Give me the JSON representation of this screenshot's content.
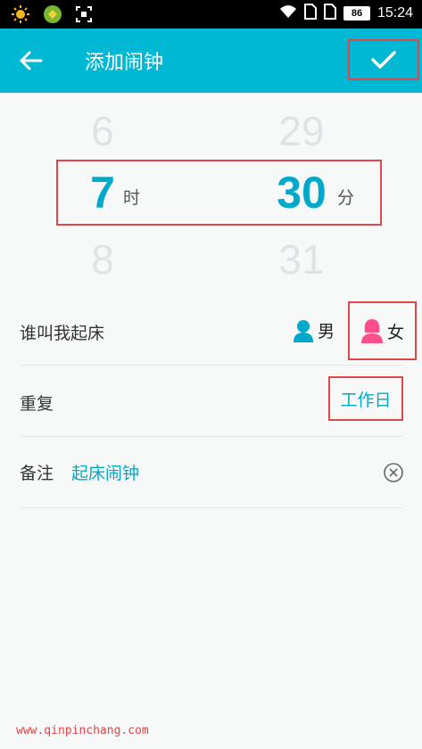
{
  "status_bar": {
    "icons": [
      "sun-icon",
      "app-notification-icon",
      "screenshot-icon",
      "wifi-icon",
      "sim-icon",
      "sim2-icon"
    ],
    "battery": "86",
    "time": "15:24"
  },
  "app_bar": {
    "title": "添加闹钟",
    "back_icon": "arrow-left-icon",
    "confirm_icon": "check-icon"
  },
  "picker": {
    "hour": {
      "prev": "6",
      "selected": "7",
      "next": "8",
      "unit": "时"
    },
    "minute": {
      "prev": "29",
      "selected": "30",
      "next": "31",
      "unit": "分"
    }
  },
  "form": {
    "wake_label": "谁叫我起床",
    "male_label": "男",
    "female_label": "女",
    "repeat_label": "重复",
    "repeat_value": "工作日",
    "note_label": "备注",
    "note_value": "起床闹钟"
  },
  "colors": {
    "accent": "#00b8d4",
    "accent_text": "#00a9c9",
    "female": "#ff4f8b",
    "highlight": "#e0464a"
  },
  "watermark": "www.qinpinchang.com"
}
